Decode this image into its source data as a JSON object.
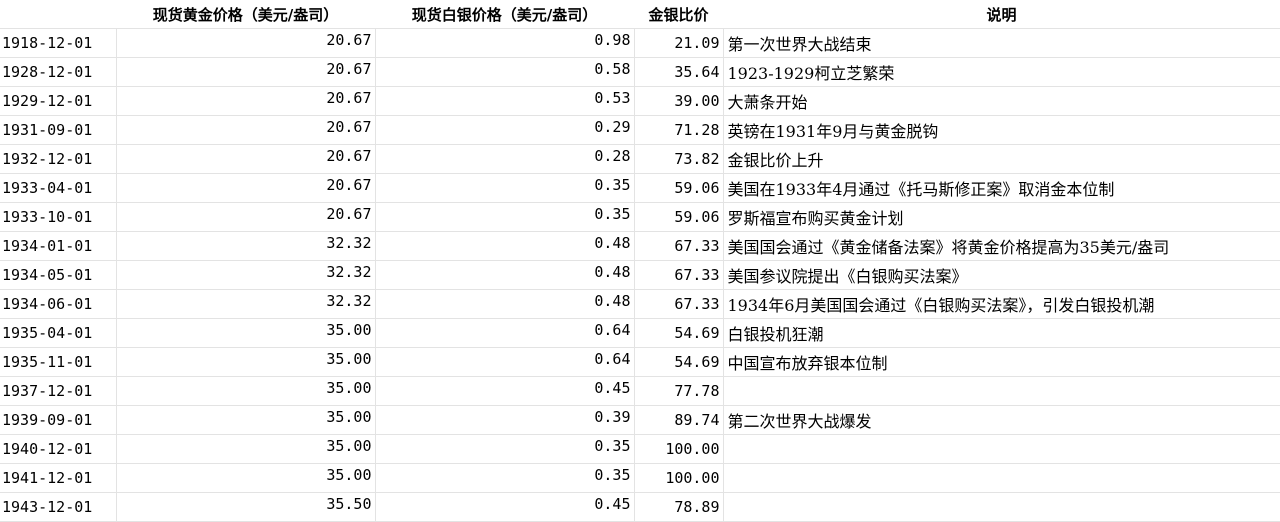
{
  "headers": {
    "date": "",
    "gold": "现货黄金价格（美元/盎司）",
    "silver": "现货白银价格（美元/盎司）",
    "ratio": "金银比价",
    "note": "说明"
  },
  "rows": [
    {
      "date": "1918-12-01",
      "gold": "20.67",
      "silver": "0.98",
      "ratio": "21.09",
      "note": "第一次世界大战结束"
    },
    {
      "date": "1928-12-01",
      "gold": "20.67",
      "silver": "0.58",
      "ratio": "35.64",
      "note": "1923-1929柯立芝繁荣"
    },
    {
      "date": "1929-12-01",
      "gold": "20.67",
      "silver": "0.53",
      "ratio": "39.00",
      "note": "大萧条开始"
    },
    {
      "date": "1931-09-01",
      "gold": "20.67",
      "silver": "0.29",
      "ratio": "71.28",
      "note": "英镑在1931年9月与黄金脱钩"
    },
    {
      "date": "1932-12-01",
      "gold": "20.67",
      "silver": "0.28",
      "ratio": "73.82",
      "note": "金银比价上升"
    },
    {
      "date": "1933-04-01",
      "gold": "20.67",
      "silver": "0.35",
      "ratio": "59.06",
      "note": "美国在1933年4月通过《托马斯修正案》取消金本位制"
    },
    {
      "date": "1933-10-01",
      "gold": "20.67",
      "silver": "0.35",
      "ratio": "59.06",
      "note": "罗斯福宣布购买黄金计划"
    },
    {
      "date": "1934-01-01",
      "gold": "32.32",
      "silver": "0.48",
      "ratio": "67.33",
      "note": "美国国会通过《黄金储备法案》将黄金价格提高为35美元/盎司"
    },
    {
      "date": "1934-05-01",
      "gold": "32.32",
      "silver": "0.48",
      "ratio": "67.33",
      "note": "美国参议院提出《白银购买法案》"
    },
    {
      "date": "1934-06-01",
      "gold": "32.32",
      "silver": "0.48",
      "ratio": "67.33",
      "note": "1934年6月美国国会通过《白银购买法案》，引发白银投机潮"
    },
    {
      "date": "1935-04-01",
      "gold": "35.00",
      "silver": "0.64",
      "ratio": "54.69",
      "note": "白银投机狂潮"
    },
    {
      "date": "1935-11-01",
      "gold": "35.00",
      "silver": "0.64",
      "ratio": "54.69",
      "note": "中国宣布放弃银本位制"
    },
    {
      "date": "1937-12-01",
      "gold": "35.00",
      "silver": "0.45",
      "ratio": "77.78",
      "note": ""
    },
    {
      "date": "1939-09-01",
      "gold": "35.00",
      "silver": "0.39",
      "ratio": "89.74",
      "note": "第二次世界大战爆发"
    },
    {
      "date": "1940-12-01",
      "gold": "35.00",
      "silver": "0.35",
      "ratio": "100.00",
      "note": ""
    },
    {
      "date": "1941-12-01",
      "gold": "35.00",
      "silver": "0.35",
      "ratio": "100.00",
      "note": ""
    },
    {
      "date": "1943-12-01",
      "gold": "35.50",
      "silver": "0.45",
      "ratio": "78.89",
      "note": ""
    }
  ]
}
